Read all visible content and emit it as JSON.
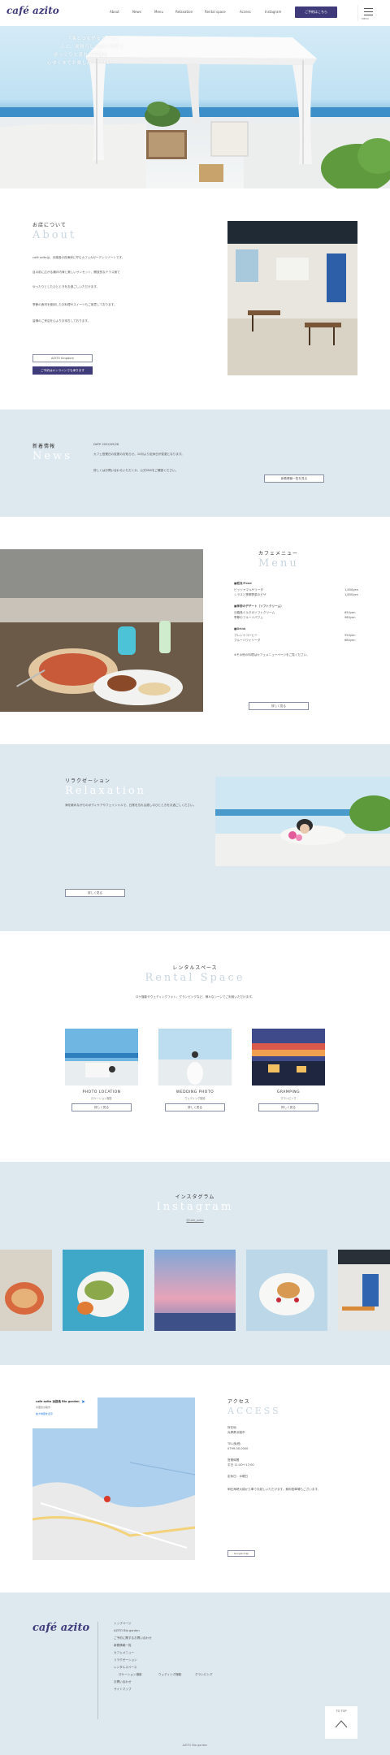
{
  "header": {
    "logo": "café azito",
    "nav": [
      "About",
      "News",
      "Menu",
      "Relaxation",
      "Rental space",
      "Access",
      "Instagram"
    ],
    "reserve_label": "ご予約はこちら",
    "menu_label": "MENU"
  },
  "hero": {
    "lines": [
      "『海とつながるカフェ』",
      "ふと、見晴らしの良い場所で",
      "ゆっくりと流れる時間を",
      "心ゆくまでお楽しみください"
    ]
  },
  "about": {
    "title_ja": "お店について",
    "title_en": "About",
    "paragraphs": [
      "café azitoは、淡路島の西海岸に佇むカフェ&ガーデンリゾートです。",
      "目の前に広がる瀬戸内海と美しいサンセット、開放的なテラス席で",
      "ゆったりとしたひとときをお過ごしいただけます。",
      "季節の食材を使用したお料理やスイーツもご用意しております。",
      "皆様のご来店を心よりお待ちしております。"
    ],
    "btn_primary": "AZITO Kingdom",
    "btn_secondary": "ご予約はオンラインでも承ります"
  },
  "news": {
    "title_ja": "新着情報",
    "title_en": "News",
    "date": "DATE 2022/09/28",
    "text_1": "カフェ営業日の変更のお知らせ。10月より定休日が変更となります。",
    "text_2": "詳しくはお問い合わせいただくか、公式SNSをご確認ください。",
    "more_label": "新着情報一覧を見る"
  },
  "menu_section": {
    "title_ja": "カフェメニュー",
    "title_en": "Menu",
    "groups": [
      {
        "heading": "■軽食/Food",
        "items": [
          [
            "ピッツァマルゲリータ",
            "1,650yen"
          ],
          [
            "シラスと季節野菜のピザ",
            "1,850yen"
          ]
        ]
      },
      {
        "heading": "■季節のデザート（ソフトクリーム）",
        "items": [
          [
            "淡路島ミルクのソフトクリーム",
            "650yen"
          ],
          [
            "季節のフルーツパフェ",
            "980yen"
          ]
        ]
      },
      {
        "heading": "■Drink",
        "items": [
          [
            "ブレンドコーヒー",
            "550yen"
          ],
          [
            "ブルーハワイソーダ",
            "680yen"
          ]
        ]
      }
    ],
    "note": "※その他の料理はカフェメニューページをご覧ください。",
    "more_label": "詳しく見る"
  },
  "relax": {
    "title_ja": "リラクゼーション",
    "title_en": "Relaxation",
    "text": "海を眺めながらのボディケアやフェイシャルで、日常を忘れる癒しのひとときをお過ごしください。",
    "more_label": "詳しく見る"
  },
  "rental": {
    "title_ja": "レンタルスペース",
    "title_en": "Rental Space",
    "intro": "ロケ撮影やウェディングフォト、グランピングなど、様々なシーンでご利用いただけます。",
    "cards": [
      {
        "label": "PHOTO LOCATION",
        "sub": "ロケーション撮影",
        "btn": "詳しく見る"
      },
      {
        "label": "WEDDING PHOTO",
        "sub": "ウェディング撮影",
        "btn": "詳しく見る"
      },
      {
        "label": "GRAMPING",
        "sub": "グランピング",
        "btn": "詳しく見る"
      }
    ]
  },
  "instagram": {
    "title_ja": "インスタグラム",
    "title_en": "Instagram",
    "handle": "@cafe_azito"
  },
  "access": {
    "title_ja": "アクセス",
    "title_en": "ACCESS",
    "map_place": "cafe azito 淡路島 Bio garden",
    "map_sub": "兵庫県淡路市",
    "map_link": "拡大地図を表示",
    "address_label": "所在地",
    "address": "兵庫県淡路市",
    "tel_label": "TEL(免税)",
    "tel": "0799-00-0000",
    "hours_label": "営業時間",
    "hours": "平日 11:00〜17:00",
    "holiday": "定休日：水曜日",
    "description": "明石海峡大橋から車でお越しいただけます。無料駐車場もございます。",
    "more_label": "Google map"
  },
  "footer": {
    "logo": "café azito",
    "links": [
      "トップページ",
      "AZITO Bio garden",
      "ご予約に関するお問い合わせ",
      "新着情報一覧",
      "カフェメニュー",
      "リラクゼーション",
      "レンタルスペース",
      "ロケーション撮影",
      "ウェディング撮影",
      "グランピング",
      "お問い合わせ",
      "サイトマップ"
    ],
    "to_top": "TO TOP",
    "copyright": "AZITO Bio garden"
  },
  "colors": {
    "brand": "#3f3b7a",
    "section_blue": "#dde8ef"
  }
}
